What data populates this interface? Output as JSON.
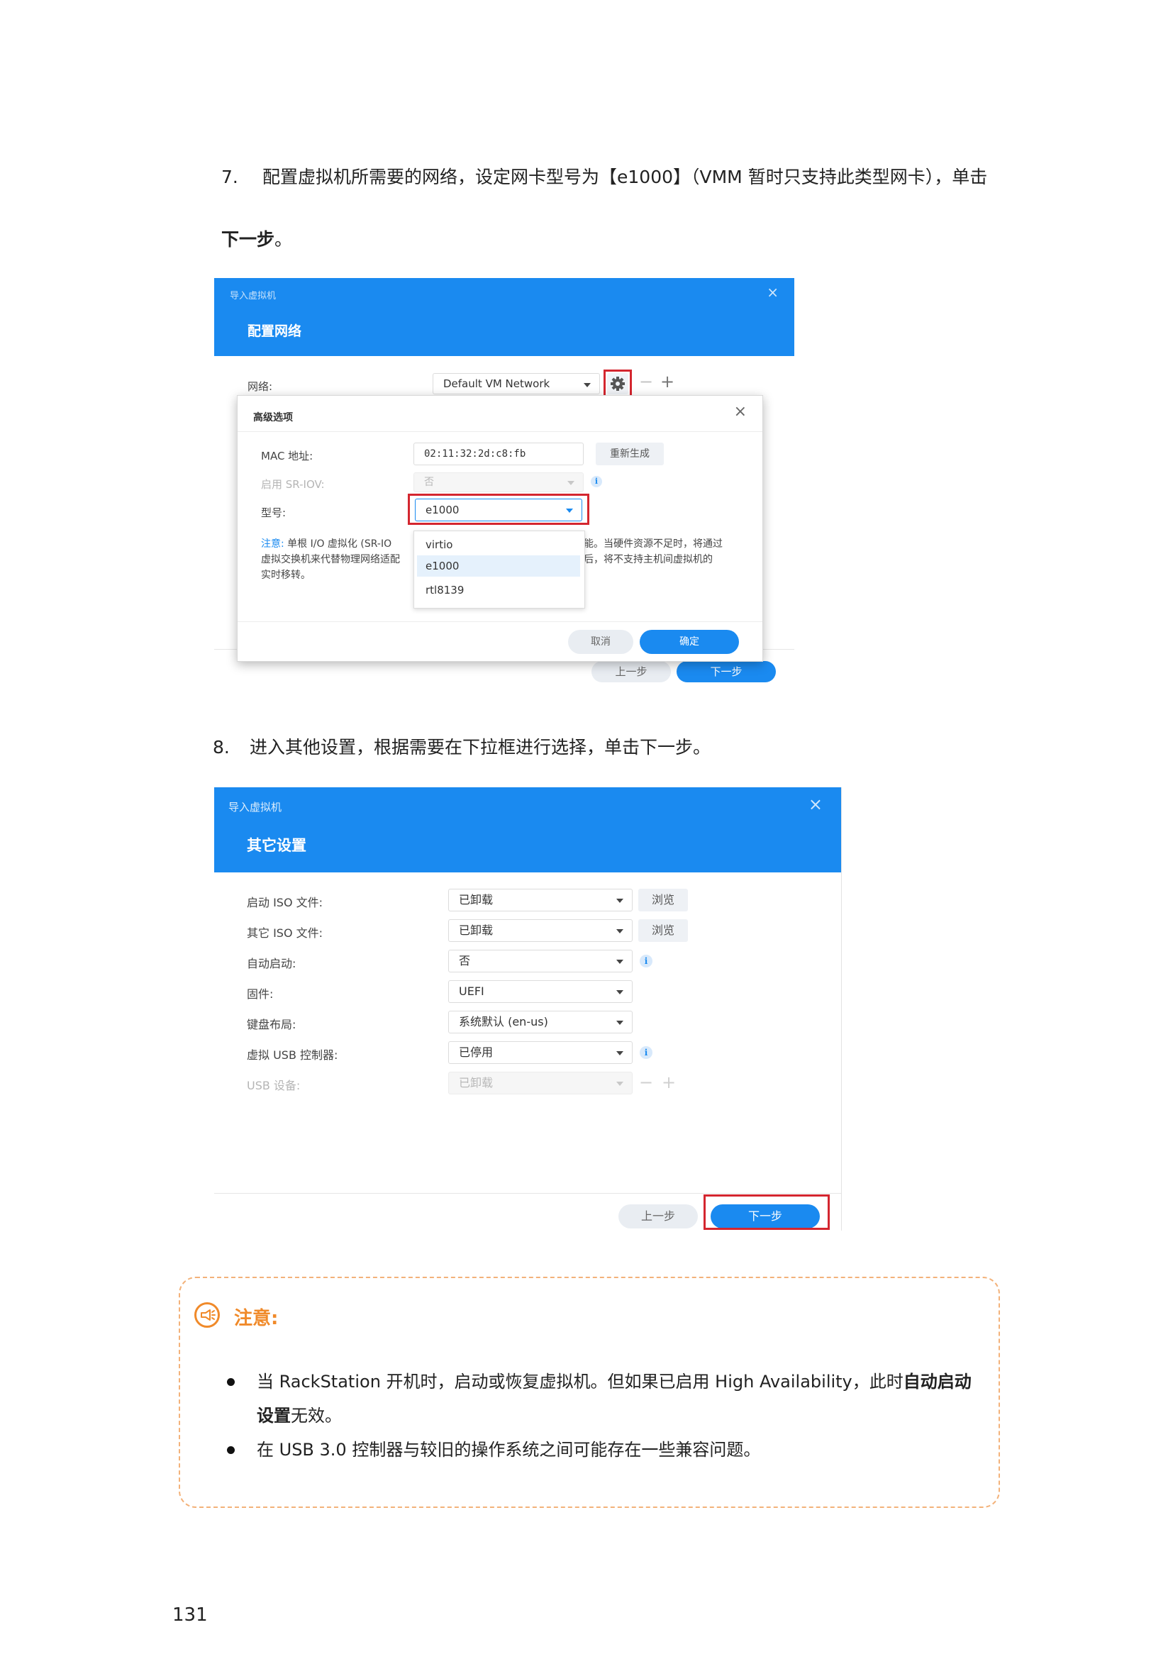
{
  "step7": {
    "num": "7.",
    "line1": "配置虚拟机所需要的网络，设定网卡型号为【e1000】（VMM  暂时只支持此类型网卡），单击",
    "line2_bold": "下一步",
    "line2_tail": "。"
  },
  "dialog1": {
    "small_title": "导入虚拟机",
    "title": "配置网络",
    "close": "×",
    "network_label": "网络:",
    "network_value": "Default VM Network",
    "minus": "−",
    "plus": "+",
    "prev_button": "上一步",
    "next_button": "下一步",
    "advanced": {
      "title": "高级选项",
      "close": "×",
      "mac_label": "MAC 地址:",
      "mac_value": "02:11:32:2d:c8:fb",
      "regenerate": "重新生成",
      "sriov_label": "启用 SR-IOV:",
      "sriov_value": "否",
      "info": "i",
      "model_label": "型号:",
      "model_value": "e1000",
      "note_prefix": "注意:",
      "note_line1_a": "单根 I/O 虚拟化 (SR-IO",
      "note_line1_b": "能。当硬件资源不足时，将通过",
      "note_line2_a": "虚拟交换机来代替物理网络适配",
      "note_line2_b": "后，将不支持主机间虚拟机的",
      "note_line3": "实时移转。",
      "options": [
        "virtio",
        "e1000",
        "rtl8139"
      ],
      "cancel": "取消",
      "ok": "确定"
    }
  },
  "step8": {
    "num": "8.",
    "text": "进入其他设置，根据需要在下拉框进行选择，单击下一步。"
  },
  "dialog2": {
    "small_title": "导入虚拟机",
    "title": "其它设置",
    "close": "×",
    "rows": [
      {
        "label": "启动 ISO 文件:",
        "value": "已卸载",
        "extra": "浏览"
      },
      {
        "label": "其它 ISO 文件:",
        "value": "已卸载",
        "extra": "浏览"
      },
      {
        "label": "自动启动:",
        "value": "否",
        "extra": "i"
      },
      {
        "label": "固件:",
        "value": "UEFI",
        "extra": ""
      },
      {
        "label": "键盘布局:",
        "value": "系统默认 (en-us)",
        "extra": ""
      },
      {
        "label": "虚拟 USB 控制器:",
        "value": "已停用",
        "extra": "i"
      },
      {
        "label": "USB 设备:",
        "value": "已卸载",
        "extra": ""
      }
    ],
    "minus": "−",
    "plus": "+",
    "prev_button": "上一步",
    "next_button": "下一步"
  },
  "notice": {
    "title": "注意:",
    "bullet1_a": "当 RackStation 开机时，启动或恢复虚拟机。但如果已启用 High Availability，此时",
    "bullet1_bold": "自动启动设置",
    "bullet1_tail": "无效。",
    "bullet2": "在 USB 3.0 控制器与较旧的操作系统之间可能存在一些兼容问题。"
  },
  "page_number": "131",
  "colors": {
    "accent_blue": "#1a8af0",
    "highlight_red": "#d4262f",
    "notice_orange": "#f08a2a"
  }
}
